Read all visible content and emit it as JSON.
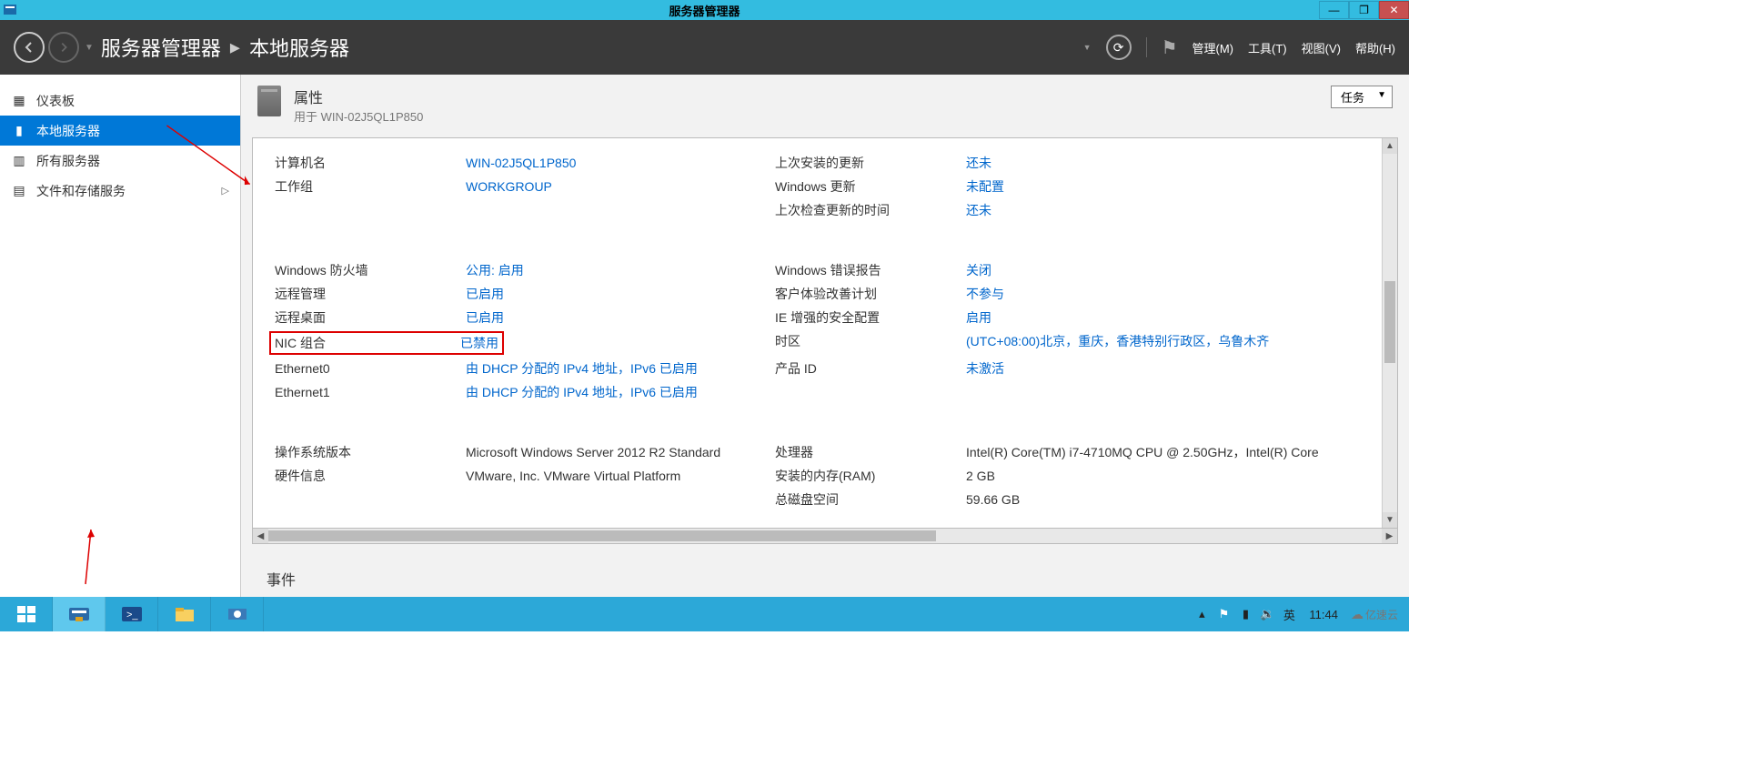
{
  "titlebar": {
    "title": "服务器管理器"
  },
  "header": {
    "breadcrumb_root": "服务器管理器",
    "breadcrumb_page": "本地服务器",
    "menu": {
      "manage": "管理(M)",
      "tools": "工具(T)",
      "view": "视图(V)",
      "help": "帮助(H)"
    }
  },
  "sidebar": {
    "items": [
      {
        "label": "仪表板"
      },
      {
        "label": "本地服务器"
      },
      {
        "label": "所有服务器"
      },
      {
        "label": "文件和存储服务"
      }
    ]
  },
  "properties": {
    "title": "属性",
    "subtitle": "用于 WIN-02J5QL1P850",
    "tasks_label": "任务",
    "rows_group1": [
      {
        "l1": "计算机名",
        "v1": "WIN-02J5QL1P850",
        "v1link": true,
        "l2": "上次安装的更新",
        "v2": "还未",
        "v2link": true
      },
      {
        "l1": "工作组",
        "v1": "WORKGROUP",
        "v1link": true,
        "l2": "Windows 更新",
        "v2": "未配置",
        "v2link": true
      },
      {
        "l1": "",
        "v1": "",
        "l2": "上次检查更新的时间",
        "v2": "还未",
        "v2link": true
      }
    ],
    "rows_group2": [
      {
        "l1": "Windows 防火墙",
        "v1": "公用: 启用",
        "v1link": true,
        "l2": "Windows 错误报告",
        "v2": "关闭",
        "v2link": true
      },
      {
        "l1": "远程管理",
        "v1": "已启用",
        "v1link": true,
        "l2": "客户体验改善计划",
        "v2": "不参与",
        "v2link": true
      },
      {
        "l1": "远程桌面",
        "v1": "已启用",
        "v1link": true,
        "l2": "IE 增强的安全配置",
        "v2": "启用",
        "v2link": true
      },
      {
        "l1": "NIC 组合",
        "v1": "已禁用",
        "v1link": true,
        "highlight": true,
        "l2": "时区",
        "v2": "(UTC+08:00)北京，重庆，香港特别行政区，乌鲁木齐",
        "v2link": true
      },
      {
        "l1": "Ethernet0",
        "v1": "由 DHCP 分配的 IPv4 地址，IPv6 已启用",
        "v1link": true,
        "l2": "产品 ID",
        "v2": "未激活",
        "v2link": true
      },
      {
        "l1": "Ethernet1",
        "v1": "由 DHCP 分配的 IPv4 地址，IPv6 已启用",
        "v1link": true,
        "l2": "",
        "v2": ""
      }
    ],
    "rows_group3": [
      {
        "l1": "操作系统版本",
        "v1": "Microsoft Windows Server 2012 R2 Standard",
        "l2": "处理器",
        "v2": "Intel(R) Core(TM) i7-4710MQ CPU @ 2.50GHz，Intel(R) Core"
      },
      {
        "l1": "硬件信息",
        "v1": "VMware, Inc. VMware Virtual Platform",
        "l2": "安装的内存(RAM)",
        "v2": "2 GB"
      },
      {
        "l1": "",
        "v1": "",
        "l2": "总磁盘空间",
        "v2": "59.66 GB"
      }
    ]
  },
  "events": {
    "title": "事件"
  },
  "taskbar": {
    "ime": "英",
    "time": "11:44",
    "watermark": "亿速云"
  }
}
